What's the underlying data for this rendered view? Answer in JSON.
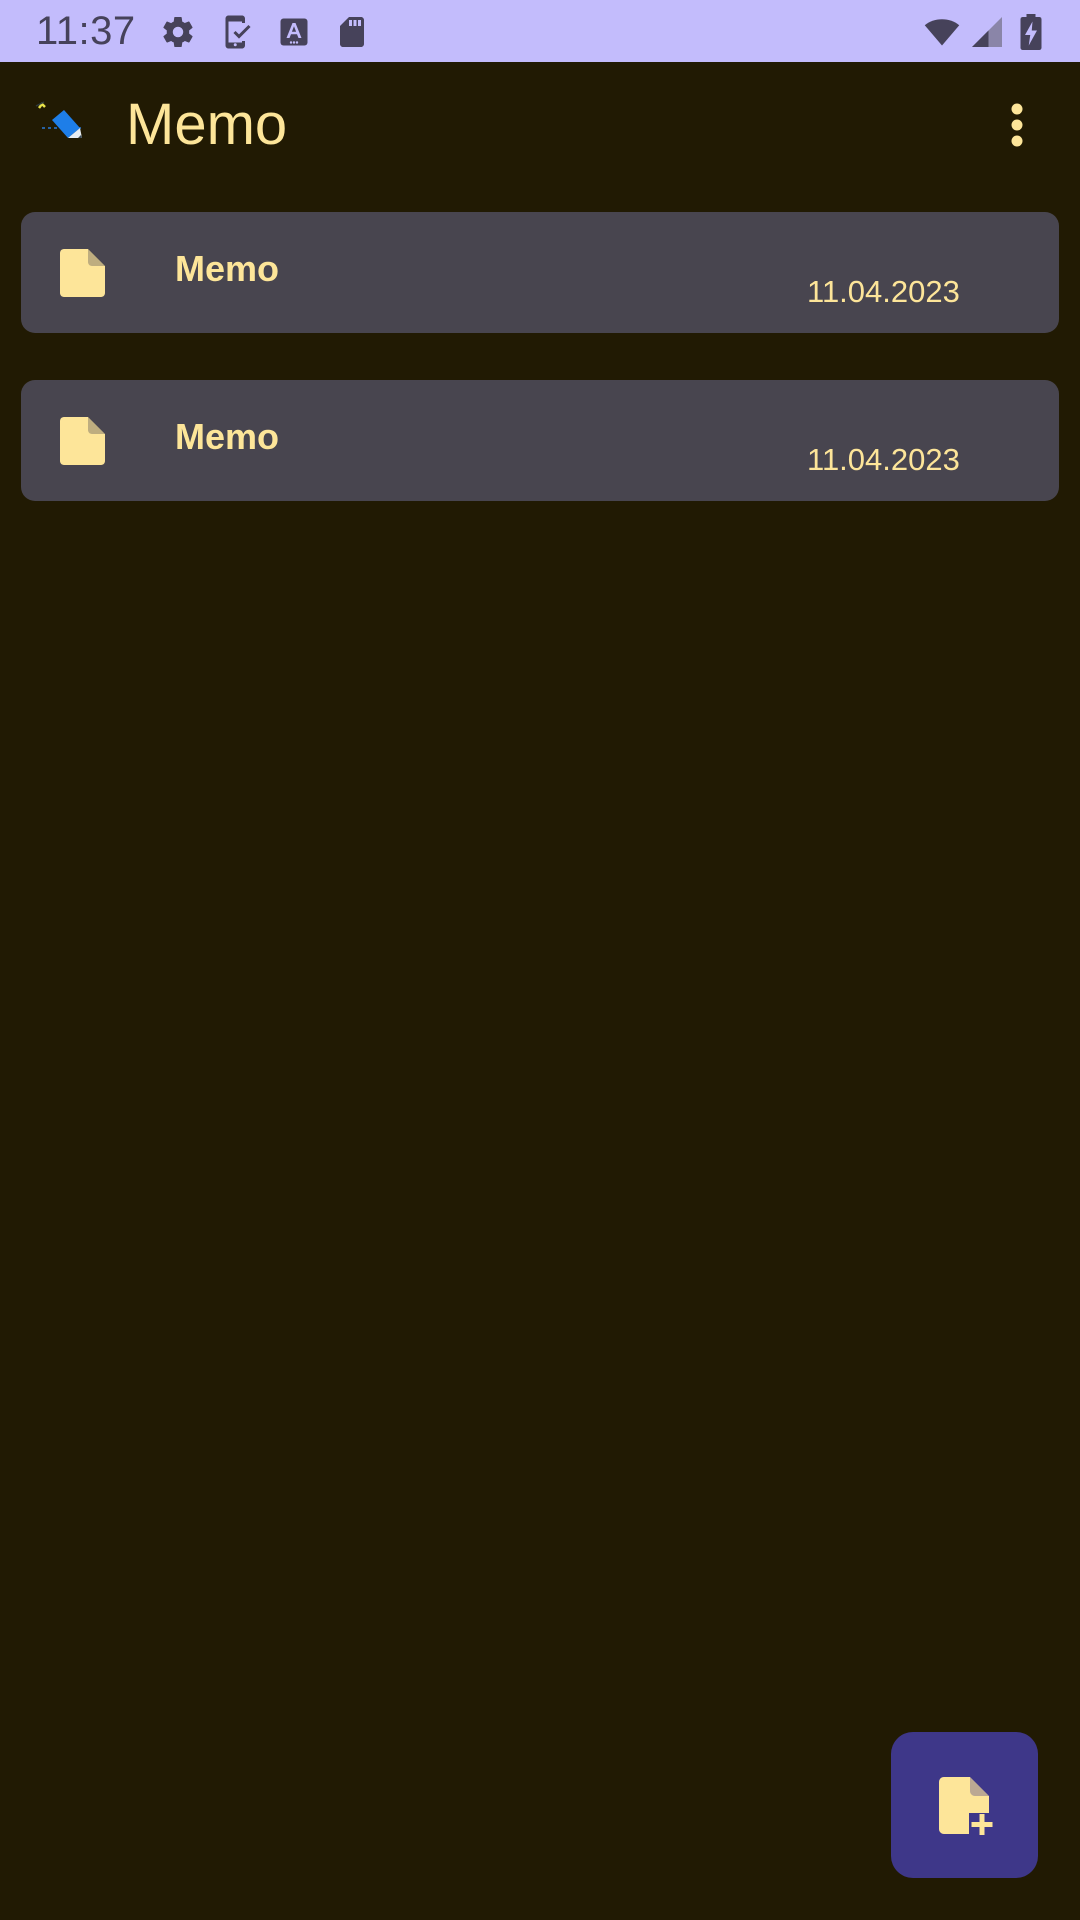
{
  "status_bar": {
    "time": "11:37",
    "icons": [
      "settings-icon",
      "phone-check-icon",
      "text-a-icon",
      "sd-card-icon",
      "wifi-icon",
      "signal-icon",
      "battery-charging-icon"
    ],
    "background": "#c3bcfc"
  },
  "app_bar": {
    "title": "Memo",
    "logo_icon": "pencil-logo-icon",
    "overflow_icon": "more-vertical-icon"
  },
  "memos": [
    {
      "title": "Memo",
      "date": "11.04.2023",
      "icon": "note-icon"
    },
    {
      "title": "Memo",
      "date": "11.04.2023",
      "icon": "note-icon"
    }
  ],
  "fab": {
    "icon": "note-add-icon"
  },
  "colors": {
    "background": "#211a03",
    "card": "#48454f",
    "accent_text": "#fde599",
    "fab": "#3e3789"
  }
}
